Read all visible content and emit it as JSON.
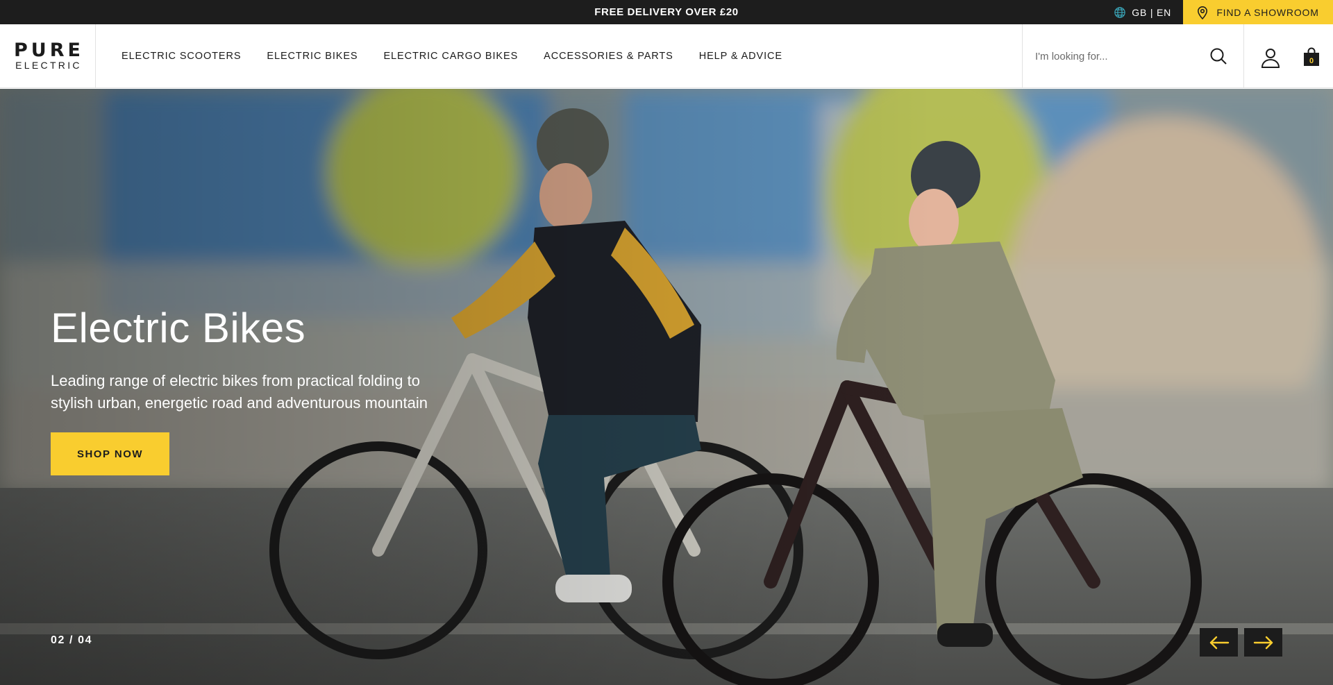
{
  "topbar": {
    "promo": "FREE DELIVERY OVER £20",
    "locale": "GB | EN",
    "showroom_label": "FIND A SHOWROOM"
  },
  "brand": {
    "line1": "PURE",
    "line2": "ELECTRIC"
  },
  "nav": {
    "items": [
      {
        "label": "ELECTRIC SCOOTERS"
      },
      {
        "label": "ELECTRIC BIKES"
      },
      {
        "label": "ELECTRIC CARGO BIKES"
      },
      {
        "label": "ACCESSORIES & PARTS"
      },
      {
        "label": "HELP & ADVICE"
      }
    ]
  },
  "search": {
    "placeholder": "I'm looking for..."
  },
  "cart": {
    "count": "0"
  },
  "hero": {
    "title": "Electric Bikes",
    "description": "Leading range of electric bikes from practical folding to stylish urban, energetic road and adventurous mountain",
    "cta": "SHOP NOW",
    "slide_counter": "02 / 04"
  },
  "colors": {
    "accent": "#f9cd2f",
    "dark": "#1d1d1d",
    "hero_arrow": "#f9cd2f"
  },
  "icons": {
    "locale": "globe-icon",
    "showroom": "map-pin-icon",
    "search": "search-icon",
    "account": "user-icon",
    "cart": "shopping-bag-icon",
    "prev": "arrow-left-icon",
    "next": "arrow-right-icon"
  }
}
